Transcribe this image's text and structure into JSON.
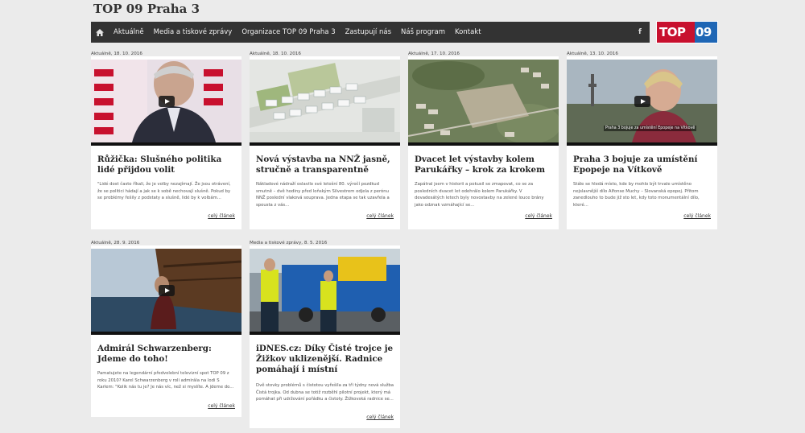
{
  "site": {
    "title": "TOP 09 Praha 3"
  },
  "nav": {
    "items": [
      "Aktuálně",
      "Media a tiskové zprávy",
      "Organizace TOP 09 Praha 3",
      "Zastupují nás",
      "Náš program",
      "Kontakt"
    ],
    "fb_glyph": "f"
  },
  "logo": {
    "part1": "TOP",
    "part2": "09",
    "colors": {
      "red": "#c8102e",
      "blue": "#1e66b5"
    }
  },
  "more_label": "celý článek",
  "articles": [
    {
      "date": "Aktuálně, 18. 10. 2016",
      "title": "Růžička: Slušného politika lidé přijdou volit",
      "excerpt": "\"Lidé dost často říkali, že je volby nezajímají. Že jsou otrávení, že se politici hádají a jak se k sobě nechovají slušně. Pokud by se problémy řešily z podstaty a slušně, lidé by k volbám...",
      "video": true,
      "image_icon": "interview-video-image"
    },
    {
      "date": "Aktuálně, 18. 10. 2016",
      "title": "Nová výstavba na NNŽ jasně, stručně a transparentně",
      "excerpt": "Nákladové nádraží oslavilo své letošní 80. výročí pozdkud smutně – dvě hodiny před loňským Silvestrem odjela z perónu NNŽ poslední vlaková souprava. Jedna etapa se tak uzavřela a spousta z vás...",
      "video": false,
      "image_icon": "aerial-plan-image"
    },
    {
      "date": "Aktuálně, 17. 10. 2016",
      "title": "Dvacet let výstavby kolem Parukářky – krok za krokem",
      "excerpt": "Zapátral jsem v historii a pokusil se zmapovat, co se za posledních dvacet let odehrálo kolem Parukářky. V devadesátých letech byly novostavby na zelené louce brány jako odznak vzmáhající se...",
      "video": false,
      "image_icon": "aerial-photo-image"
    },
    {
      "date": "Aktuálně, 13. 10. 2016",
      "title": "Praha 3 bojuje za umístění Epopeje na Vítkově",
      "excerpt": "Stále se hledá místo, kde by mohlo být trvale umístěno nejslavnější dílo Alfonse Muchy – Slovanská epopej. Přitom zanedlouho to bude již sto let, kdy toto monumentální dílo, které...",
      "video": true,
      "video_caption": "Praha 3 bojuje za umístění Epopeje na Vítkově",
      "image_icon": "woman-video-image"
    },
    {
      "date": "Aktuálně, 28. 9. 2016",
      "title": "Admirál Schwarzenberg: Jdeme do toho!",
      "excerpt": "Pamatujete na legendární předvolební televizní spot TOP 09 z roku 2010? Karel Schwarzenberg v roli admirála na lodi S Karlem: \"Kolik nás tu je? Je nás víc, než si myslíte. A jdeme do...",
      "video": true,
      "image_icon": "ship-video-image"
    },
    {
      "date": "Media a tiskové zprávy, 8. 5. 2016",
      "title": "iDNES.cz: Díky Čisté trojce je Žižkov uklizenější. Radnice pomáhají i místní",
      "excerpt": "Dvě stovky problémů s čistotou vyřešila za tři týdny nová služba Čistá trojka. Od dubna se totiž rozběhl pilotní projekt, který má pomáhat při udržování pořádku a čistoty. Žižkovská radnice se...",
      "video": false,
      "image_icon": "street-workers-image"
    }
  ]
}
